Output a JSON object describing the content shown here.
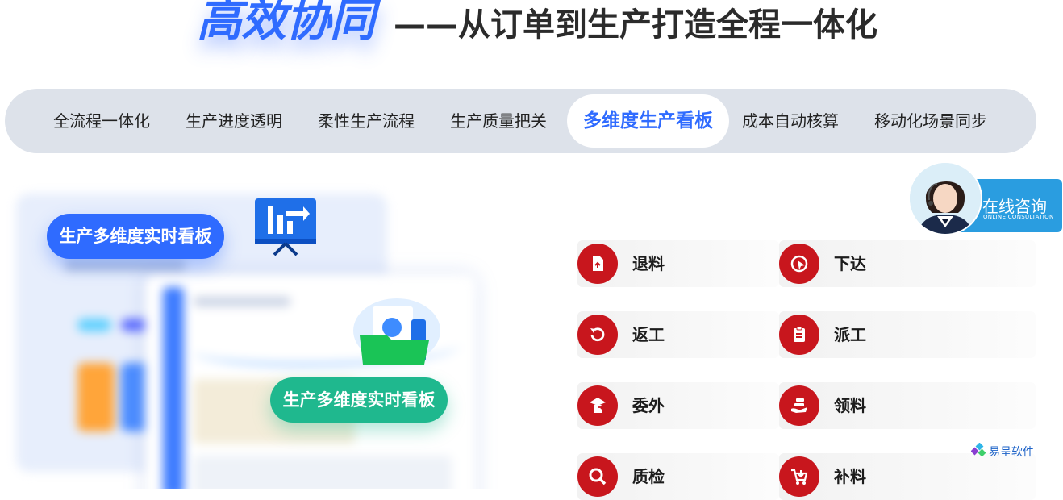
{
  "headline": {
    "emphasis": "高效协同",
    "rest": "——从订单到生产打造全程一体化"
  },
  "tabs": [
    {
      "label": "全流程一体化",
      "active": false
    },
    {
      "label": "生产进度透明",
      "active": false
    },
    {
      "label": "柔性生产流程",
      "active": false
    },
    {
      "label": "生产质量把关",
      "active": false
    },
    {
      "label": "多维度生产看板",
      "active": true
    },
    {
      "label": "成本自动核算",
      "active": false
    },
    {
      "label": "移动化场景同步",
      "active": false
    }
  ],
  "illustration": {
    "label_top": "生产多维度实时看板",
    "label_bottom": "生产多维度实时看板"
  },
  "features": [
    {
      "label": "退料",
      "icon": "return-material-icon"
    },
    {
      "label": "下达",
      "icon": "dispatch-icon"
    },
    {
      "label": "返工",
      "icon": "rework-icon"
    },
    {
      "label": "派工",
      "icon": "assign-work-icon"
    },
    {
      "label": "委外",
      "icon": "outsource-icon"
    },
    {
      "label": "领料",
      "icon": "receive-material-icon"
    },
    {
      "label": "质检",
      "icon": "quality-inspection-icon"
    },
    {
      "label": "补料",
      "icon": "replenish-material-icon"
    }
  ],
  "consult": {
    "title": "在线咨询",
    "subtitle": "ONLINE CONSULTATION"
  },
  "brand": {
    "name": "易呈软件"
  },
  "colors": {
    "accent": "#2f6bff",
    "tab_bar": "#dde2ea",
    "feature_icon_bg": "#c8161d",
    "green_label": "#1fb88e",
    "consult_panel": "#2a9de0"
  }
}
